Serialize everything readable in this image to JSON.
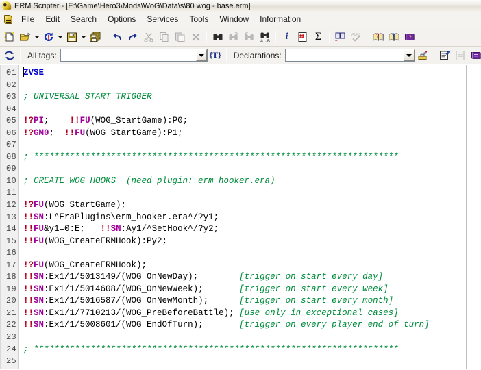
{
  "window": {
    "title": "ERM Scripter - [E:\\Game\\Hero3\\Mods\\WoG\\Data\\s\\80 wog - base.erm]",
    "app_icon": "scripter-icon"
  },
  "menubar": {
    "icon": "document-script-icon",
    "items": [
      {
        "label": "File"
      },
      {
        "label": "Edit"
      },
      {
        "label": "Search"
      },
      {
        "label": "Options"
      },
      {
        "label": "Services"
      },
      {
        "label": "Tools"
      },
      {
        "label": "Window"
      },
      {
        "label": "Information"
      }
    ]
  },
  "toolbar_main": {
    "buttons": [
      {
        "name": "new-file-button",
        "icon": "new-document-icon",
        "enabled": true
      },
      {
        "name": "open-file-button",
        "icon": "open-folder-icon",
        "enabled": true
      },
      {
        "name": "open-dropdown",
        "icon": "chevron-down-icon",
        "enabled": true
      },
      {
        "name": "reload-file-button",
        "icon": "reload-icon",
        "enabled": true
      },
      {
        "name": "reload-dropdown",
        "icon": "chevron-down-icon",
        "enabled": true
      },
      {
        "name": "save-file-button",
        "icon": "floppy-save-icon",
        "enabled": true
      },
      {
        "name": "save-dropdown",
        "icon": "chevron-down-icon",
        "enabled": true
      },
      {
        "name": "save-all-button",
        "icon": "save-all-icon",
        "enabled": true
      },
      {
        "name": "undo-button",
        "icon": "undo-arrow-icon",
        "enabled": true
      },
      {
        "name": "redo-button",
        "icon": "redo-arrow-icon",
        "enabled": true
      },
      {
        "name": "cut-button",
        "icon": "scissors-icon",
        "enabled": false
      },
      {
        "name": "copy-button",
        "icon": "copy-icon",
        "enabled": false
      },
      {
        "name": "paste-button",
        "icon": "paste-icon",
        "enabled": false
      },
      {
        "name": "delete-button",
        "icon": "x-delete-icon",
        "enabled": false
      },
      {
        "name": "find-button",
        "icon": "binoculars-icon",
        "enabled": true
      },
      {
        "name": "find-next-button",
        "icon": "binoculars-next-icon",
        "enabled": false
      },
      {
        "name": "find-prev-button",
        "icon": "binoculars-prev-icon",
        "enabled": false
      },
      {
        "name": "replace-button",
        "icon": "binoculars-replace-icon",
        "enabled": true
      },
      {
        "name": "info-button",
        "icon": "info-italic-i-icon",
        "enabled": true
      },
      {
        "name": "grid-page-button",
        "icon": "page-hash-icon",
        "enabled": true
      },
      {
        "name": "sum-button",
        "icon": "sigma-icon",
        "enabled": true
      },
      {
        "name": "add-entry-button",
        "icon": "book-add-icon",
        "enabled": true
      },
      {
        "name": "spellcheck-button",
        "icon": "abc-check-icon",
        "enabled": false
      },
      {
        "name": "help-erm-button",
        "icon": "help-book-red-icon",
        "enabled": true
      },
      {
        "name": "help-ref-button",
        "icon": "help-book-blue-icon",
        "enabled": true
      },
      {
        "name": "manual-button",
        "icon": "purple-book-icon",
        "enabled": true
      }
    ]
  },
  "toolbar_tags": {
    "refresh_button": {
      "name": "refresh-tags-button",
      "icon": "refresh-circular-icon"
    },
    "all_tags_label": "All tags:",
    "all_tags_value": "",
    "all_tags_placeholder": "",
    "tag_button_label": "{T}",
    "declarations_label": "Declarations:",
    "declarations_value": "",
    "declarations_placeholder": "",
    "buttons": [
      {
        "name": "insert-tag-button",
        "icon": "stamp-insert-icon"
      },
      {
        "name": "properties-button",
        "icon": "properties-pencil-icon"
      },
      {
        "name": "list-view-button",
        "icon": "list-document-icon"
      },
      {
        "name": "dictionary-button",
        "icon": "purple-book-icon"
      }
    ]
  },
  "editor": {
    "gutter_width": 28,
    "lines": [
      {
        "n": "01",
        "tokens": [
          {
            "t": "ZVSE",
            "c": "s-key"
          }
        ]
      },
      {
        "n": "02",
        "tokens": []
      },
      {
        "n": "03",
        "tokens": [
          {
            "t": "; UNIVERSAL START TRIGGER",
            "c": "s-cmt"
          }
        ]
      },
      {
        "n": "04",
        "tokens": []
      },
      {
        "n": "05",
        "tokens": [
          {
            "t": "!?",
            "c": "s-bang"
          },
          {
            "t": "PI",
            "c": "s-cmd"
          },
          {
            "t": ";    ",
            "c": "s-plain"
          },
          {
            "t": "!!",
            "c": "s-bang"
          },
          {
            "t": "FU",
            "c": "s-cmd"
          },
          {
            "t": "(WOG_StartGame):P0;",
            "c": "s-plain"
          }
        ]
      },
      {
        "n": "06",
        "tokens": [
          {
            "t": "!?",
            "c": "s-bang"
          },
          {
            "t": "GM0",
            "c": "s-cmd"
          },
          {
            "t": ";  ",
            "c": "s-plain"
          },
          {
            "t": "!!",
            "c": "s-bang"
          },
          {
            "t": "FU",
            "c": "s-cmd"
          },
          {
            "t": "(WOG_StartGame):P1;",
            "c": "s-plain"
          }
        ]
      },
      {
        "n": "07",
        "tokens": []
      },
      {
        "n": "08",
        "tokens": [
          {
            "t": "; ***********************************************************************",
            "c": "s-cmt"
          }
        ]
      },
      {
        "n": "09",
        "tokens": []
      },
      {
        "n": "10",
        "tokens": [
          {
            "t": "; CREATE WOG HOOKS  (need plugin: erm_hooker.era)",
            "c": "s-cmt"
          }
        ]
      },
      {
        "n": "11",
        "tokens": []
      },
      {
        "n": "12",
        "tokens": [
          {
            "t": "!?",
            "c": "s-bang"
          },
          {
            "t": "FU",
            "c": "s-cmd"
          },
          {
            "t": "(WOG_StartGame);",
            "c": "s-plain"
          }
        ]
      },
      {
        "n": "13",
        "tokens": [
          {
            "t": "!!",
            "c": "s-bang"
          },
          {
            "t": "SN",
            "c": "s-cmd"
          },
          {
            "t": ":L^EraPlugins\\erm_hooker.era^/?y1;",
            "c": "s-plain"
          }
        ]
      },
      {
        "n": "14",
        "tokens": [
          {
            "t": "!!",
            "c": "s-bang"
          },
          {
            "t": "FU",
            "c": "s-cmd"
          },
          {
            "t": "&y1=0:E;   ",
            "c": "s-plain"
          },
          {
            "t": "!!",
            "c": "s-bang"
          },
          {
            "t": "SN",
            "c": "s-cmd"
          },
          {
            "t": ":Ay1/^SetHook^/?y2;",
            "c": "s-plain"
          }
        ]
      },
      {
        "n": "15",
        "tokens": [
          {
            "t": "!!",
            "c": "s-bang"
          },
          {
            "t": "FU",
            "c": "s-cmd"
          },
          {
            "t": "(WOG_CreateERMHook):Py2;",
            "c": "s-plain"
          }
        ]
      },
      {
        "n": "16",
        "tokens": []
      },
      {
        "n": "17",
        "tokens": [
          {
            "t": "!?",
            "c": "s-bang"
          },
          {
            "t": "FU",
            "c": "s-cmd"
          },
          {
            "t": "(WOG_CreateERMHook);",
            "c": "s-plain"
          }
        ]
      },
      {
        "n": "18",
        "tokens": [
          {
            "t": "!!",
            "c": "s-bang"
          },
          {
            "t": "SN",
            "c": "s-cmd"
          },
          {
            "t": ":Ex1/1/5013149/(WOG_OnNewDay);        ",
            "c": "s-plain"
          },
          {
            "t": "[trigger on start every day]",
            "c": "s-note"
          }
        ]
      },
      {
        "n": "19",
        "tokens": [
          {
            "t": "!!",
            "c": "s-bang"
          },
          {
            "t": "SN",
            "c": "s-cmd"
          },
          {
            "t": ":Ex1/1/5014608/(WOG_OnNewWeek);       ",
            "c": "s-plain"
          },
          {
            "t": "[trigger on start every week]",
            "c": "s-note"
          }
        ]
      },
      {
        "n": "20",
        "tokens": [
          {
            "t": "!!",
            "c": "s-bang"
          },
          {
            "t": "SN",
            "c": "s-cmd"
          },
          {
            "t": ":Ex1/1/5016587/(WOG_OnNewMonth);      ",
            "c": "s-plain"
          },
          {
            "t": "[trigger on start every month]",
            "c": "s-note"
          }
        ]
      },
      {
        "n": "21",
        "tokens": [
          {
            "t": "!!",
            "c": "s-bang"
          },
          {
            "t": "SN",
            "c": "s-cmd"
          },
          {
            "t": ":Ex1/1/7710213/(WOG_PreBeforeBattle); ",
            "c": "s-plain"
          },
          {
            "t": "[use only in exceptional cases]",
            "c": "s-note"
          }
        ]
      },
      {
        "n": "22",
        "tokens": [
          {
            "t": "!!",
            "c": "s-bang"
          },
          {
            "t": "SN",
            "c": "s-cmd"
          },
          {
            "t": ":Ex1/1/5008601/(WOG_EndOfTurn);       ",
            "c": "s-plain"
          },
          {
            "t": "[trigger on every player end of turn]",
            "c": "s-note"
          }
        ]
      },
      {
        "n": "23",
        "tokens": []
      },
      {
        "n": "24",
        "tokens": [
          {
            "t": "; ***********************************************************************",
            "c": "s-cmt"
          }
        ]
      },
      {
        "n": "25",
        "tokens": []
      }
    ]
  },
  "colors": {
    "keyword": "#0000cd",
    "comment": "#008c3c",
    "bang": "#b00020",
    "command": "#a0009a",
    "plain": "#000000",
    "gutter_bg": "#f0f0f0",
    "editor_bg": "#ffffff"
  }
}
